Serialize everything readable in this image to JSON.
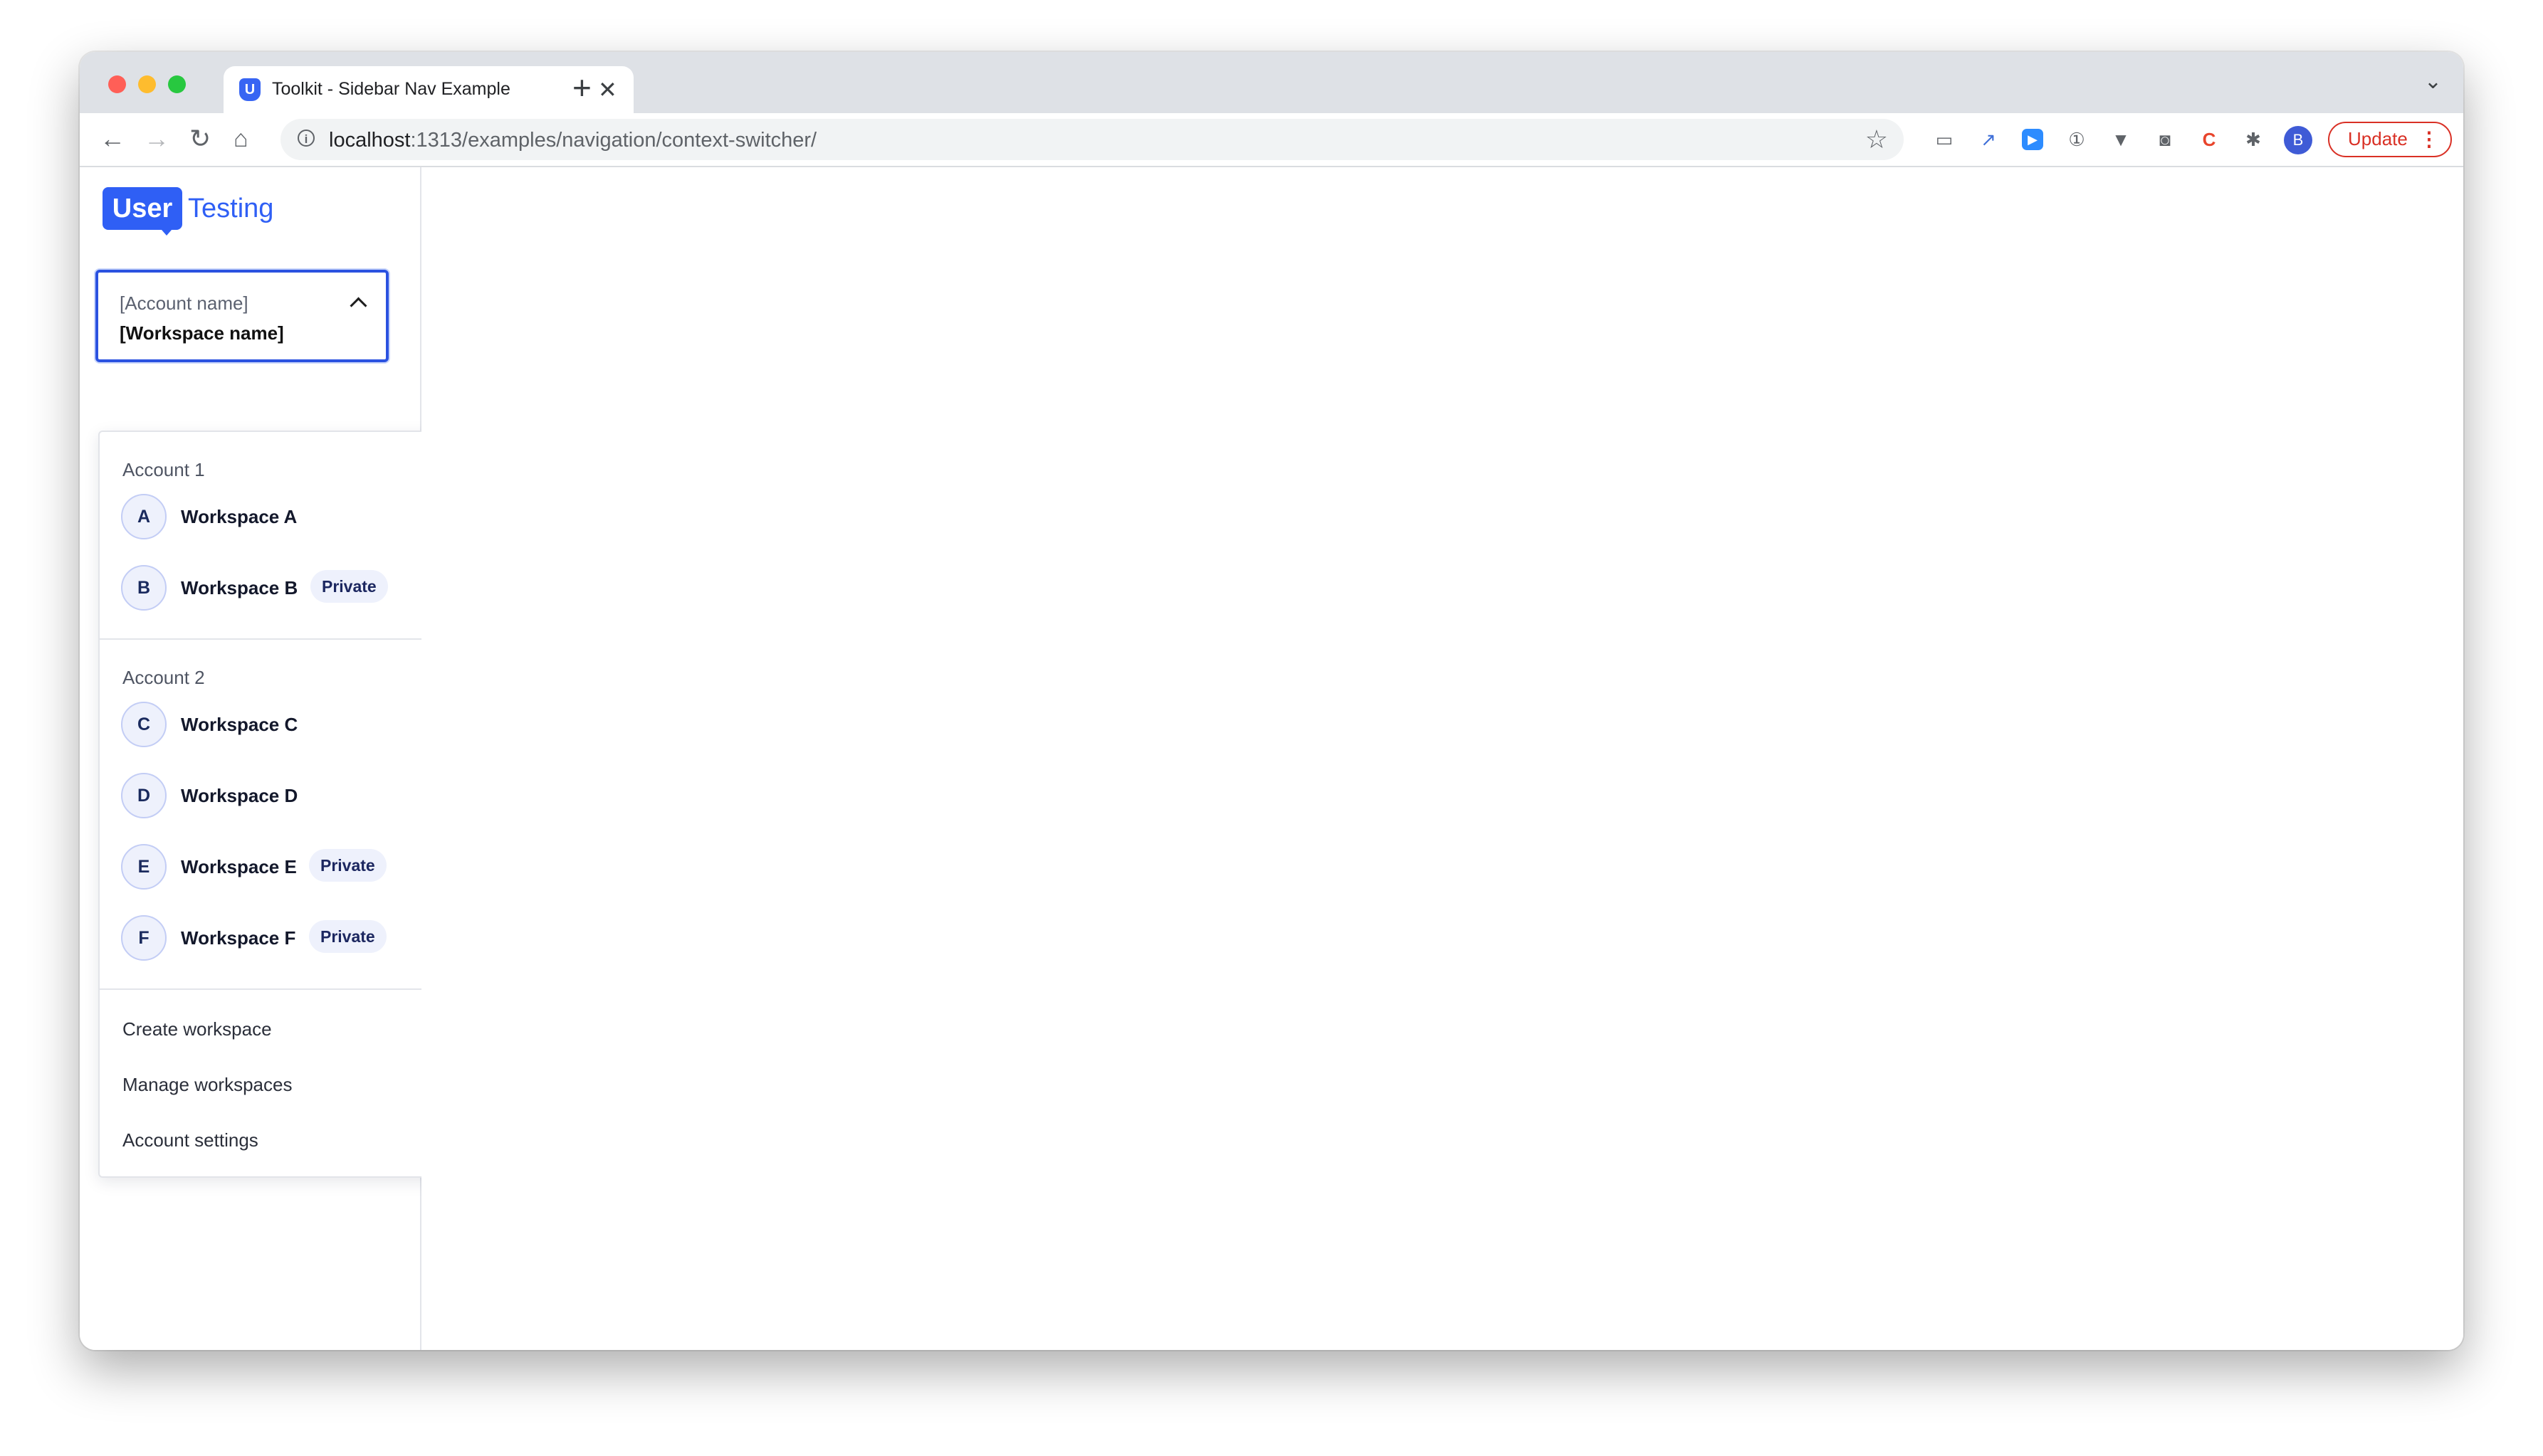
{
  "browser": {
    "tab_title": "Toolkit - Sidebar Nav Example",
    "url_host": "localhost",
    "url_path": ":1313/examples/navigation/context-switcher/",
    "profile_initial": "B",
    "update_label": "Update"
  },
  "logo": {
    "user": "User",
    "testing": "Testing"
  },
  "context_switcher": {
    "account_name": "[Account name]",
    "workspace_name": "[Workspace name]"
  },
  "dropdown": {
    "accounts": [
      {
        "label": "Account 1",
        "workspaces": [
          {
            "initial": "A",
            "name": "Workspace A",
            "badge": "",
            "selected": false
          },
          {
            "initial": "B",
            "name": "Workspace B",
            "badge": "Private",
            "selected": true
          }
        ]
      },
      {
        "label": "Account 2",
        "workspaces": [
          {
            "initial": "C",
            "name": "Workspace C",
            "badge": "",
            "selected": false
          },
          {
            "initial": "D",
            "name": "Workspace D",
            "badge": "",
            "selected": false
          },
          {
            "initial": "E",
            "name": "Workspace E",
            "badge": "Private",
            "selected": false
          },
          {
            "initial": "F",
            "name": "Workspace F",
            "badge": "Private",
            "selected": false
          }
        ]
      }
    ],
    "actions": [
      "Create workspace",
      "Manage workspaces",
      "Account settings"
    ]
  },
  "colors": {
    "brand": "#2f5ff5",
    "focus_border": "#2b52e0",
    "badge_bg": "#eef1fc",
    "update_red": "#d93025"
  }
}
